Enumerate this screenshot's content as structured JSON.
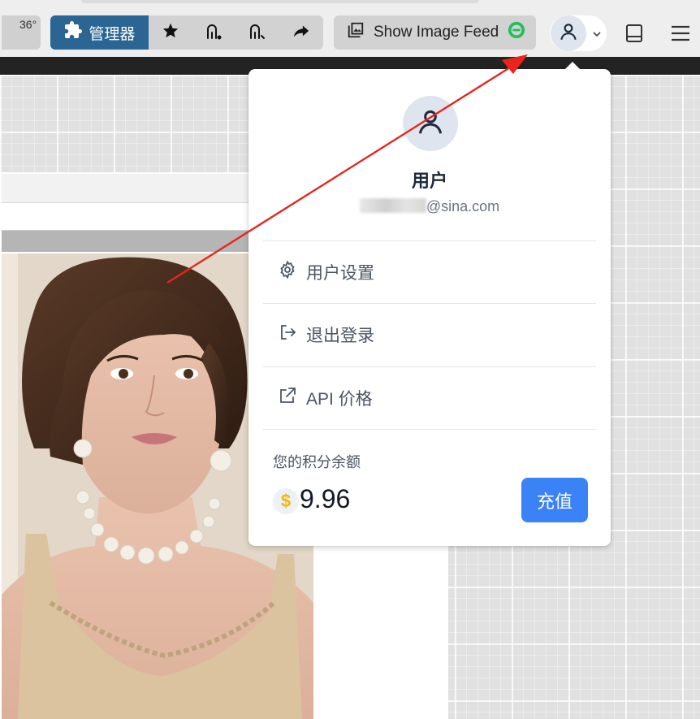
{
  "toolbar": {
    "temperature": "36°",
    "manager_label": "管理器",
    "tools": [
      "star-icon",
      "workflow-icon",
      "workflow-alt-icon",
      "share-icon"
    ],
    "feed_label": "Show Image Feed",
    "accent_color": "#2a6593"
  },
  "user_menu": {
    "username": "用户",
    "email_visible": "@sina.com",
    "items": [
      {
        "label": "用户设置",
        "icon": "gear-icon"
      },
      {
        "label": "退出登录",
        "icon": "logout-icon"
      },
      {
        "label": "API 价格",
        "icon": "external-link-icon"
      }
    ],
    "balance_label": "您的积分余额",
    "currency_symbol": "$",
    "balance": "9.96",
    "topup_label": "充值",
    "topup_color": "#3b82f6"
  },
  "annotation": {
    "color": "#e8241c"
  }
}
